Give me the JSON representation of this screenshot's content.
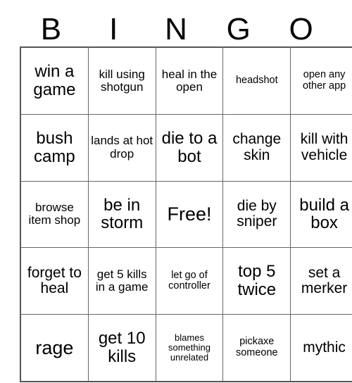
{
  "card": {
    "title": "BINGO",
    "header_letters": [
      "B",
      "I",
      "N",
      "G",
      "O"
    ],
    "free_space_label": "Free!",
    "rows": [
      [
        {
          "text": "win a game",
          "size": "lg"
        },
        {
          "text": "kill using shotgun",
          "size": "sm"
        },
        {
          "text": "heal in the open",
          "size": "sm"
        },
        {
          "text": "headshot",
          "size": "xs"
        },
        {
          "text": "open any other app",
          "size": "xs"
        }
      ],
      [
        {
          "text": "bush camp",
          "size": "lg"
        },
        {
          "text": "lands at hot drop",
          "size": "sm"
        },
        {
          "text": "die to a bot",
          "size": "lg"
        },
        {
          "text": "change skin",
          "size": "md"
        },
        {
          "text": "kill with vehicle",
          "size": "md"
        }
      ],
      [
        {
          "text": "browse item shop",
          "size": "sm"
        },
        {
          "text": "be in storm",
          "size": "lg"
        },
        {
          "text": "Free!",
          "size": "xl"
        },
        {
          "text": "die by sniper",
          "size": "md"
        },
        {
          "text": "build a box",
          "size": "lg"
        }
      ],
      [
        {
          "text": "forget to heal",
          "size": "md"
        },
        {
          "text": "get 5 kills in a game",
          "size": "sm"
        },
        {
          "text": "let go of controller",
          "size": "xs"
        },
        {
          "text": "top 5 twice",
          "size": "lg"
        },
        {
          "text": "set a merker",
          "size": "md"
        }
      ],
      [
        {
          "text": "rage",
          "size": "xl"
        },
        {
          "text": "get 10 kills",
          "size": "lg"
        },
        {
          "text": "blames something unrelated",
          "size": "xxs"
        },
        {
          "text": "pickaxe someone",
          "size": "xs"
        },
        {
          "text": "mythic",
          "size": "md"
        }
      ]
    ]
  },
  "colors": {
    "background": "#ffffff",
    "text": "#000000",
    "grid_line": "#666666",
    "grid_border": "#555555"
  }
}
